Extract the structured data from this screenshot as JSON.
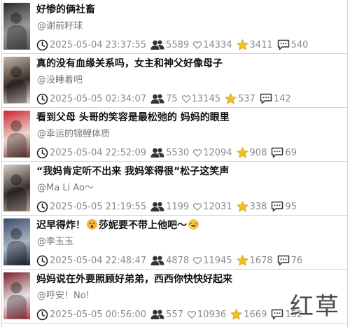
{
  "rows": [
    {
      "title": "好惨的俩社畜",
      "author": "@谢前籽球",
      "date": "2025-05-04 23:37:55",
      "views": "5589",
      "likes": "14334",
      "favorites": "3411",
      "comments": "540",
      "thumb_colors": [
        "#2a2a2a",
        "#9a9a9a",
        "#555555"
      ]
    },
    {
      "title": "真的没有血缘关系吗，女主和神父好像母子",
      "author": "@没睡着吧",
      "date": "2025-05-05 02:34:07",
      "views": "75",
      "likes": "13145",
      "favorites": "537",
      "comments": "142",
      "thumb_colors": [
        "#c9b7a6",
        "#3b2f2a",
        "#e8dfd5"
      ]
    },
    {
      "title": "看到父母 头哥的笑容是最松弛的 妈妈的眼里",
      "author": "@幸运的锦鲤体质",
      "date": "2025-05-04 22:52:09",
      "views": "5530",
      "likes": "12094",
      "favorites": "908",
      "comments": "69",
      "thumb_colors": [
        "#c8242d",
        "#f0d6cf",
        "#6b3a3a"
      ]
    },
    {
      "title": "“我妈肯定听不出来 我妈笨得很”松子这笑声",
      "author": "@Ma Li Ao～",
      "date": "2025-05-05 21:19:55",
      "views": "1199",
      "likes": "12031",
      "favorites": "338",
      "comments": "95",
      "thumb_colors": [
        "#d9cfc4",
        "#3a3130",
        "#b7a79a"
      ]
    },
    {
      "title_parts": [
        "迟早得炸！",
        "莎妮要不带上他吧～"
      ],
      "author": "@李玉玉",
      "date": "2025-05-04 22:48:47",
      "views": "4878",
      "likes": "11945",
      "favorites": "1678",
      "comments": "76",
      "thumb_colors": [
        "#3a4a6a",
        "#a9b4c6",
        "#1e2433"
      ]
    },
    {
      "title": "妈妈说在外要照顾好弟弟，西西你快快好起来",
      "author": "@呼安！No!",
      "date": "2025-05-05 00:56:00",
      "views": "557",
      "likes": "10936",
      "favorites": "1669",
      "comments": "152",
      "thumb_colors": [
        "#7a1f2a",
        "#e9e1e4",
        "#b23a4a"
      ]
    }
  ],
  "icons": {
    "clock": "clock-icon",
    "views": "people-icon",
    "likes": "heart-icon",
    "favorites": "star-icon",
    "comments": "comment-icon"
  },
  "colors": {
    "star": "#f3c21a",
    "meta_text": "#8a8a8a",
    "border": "#d6d6d6"
  },
  "watermark": "红草"
}
